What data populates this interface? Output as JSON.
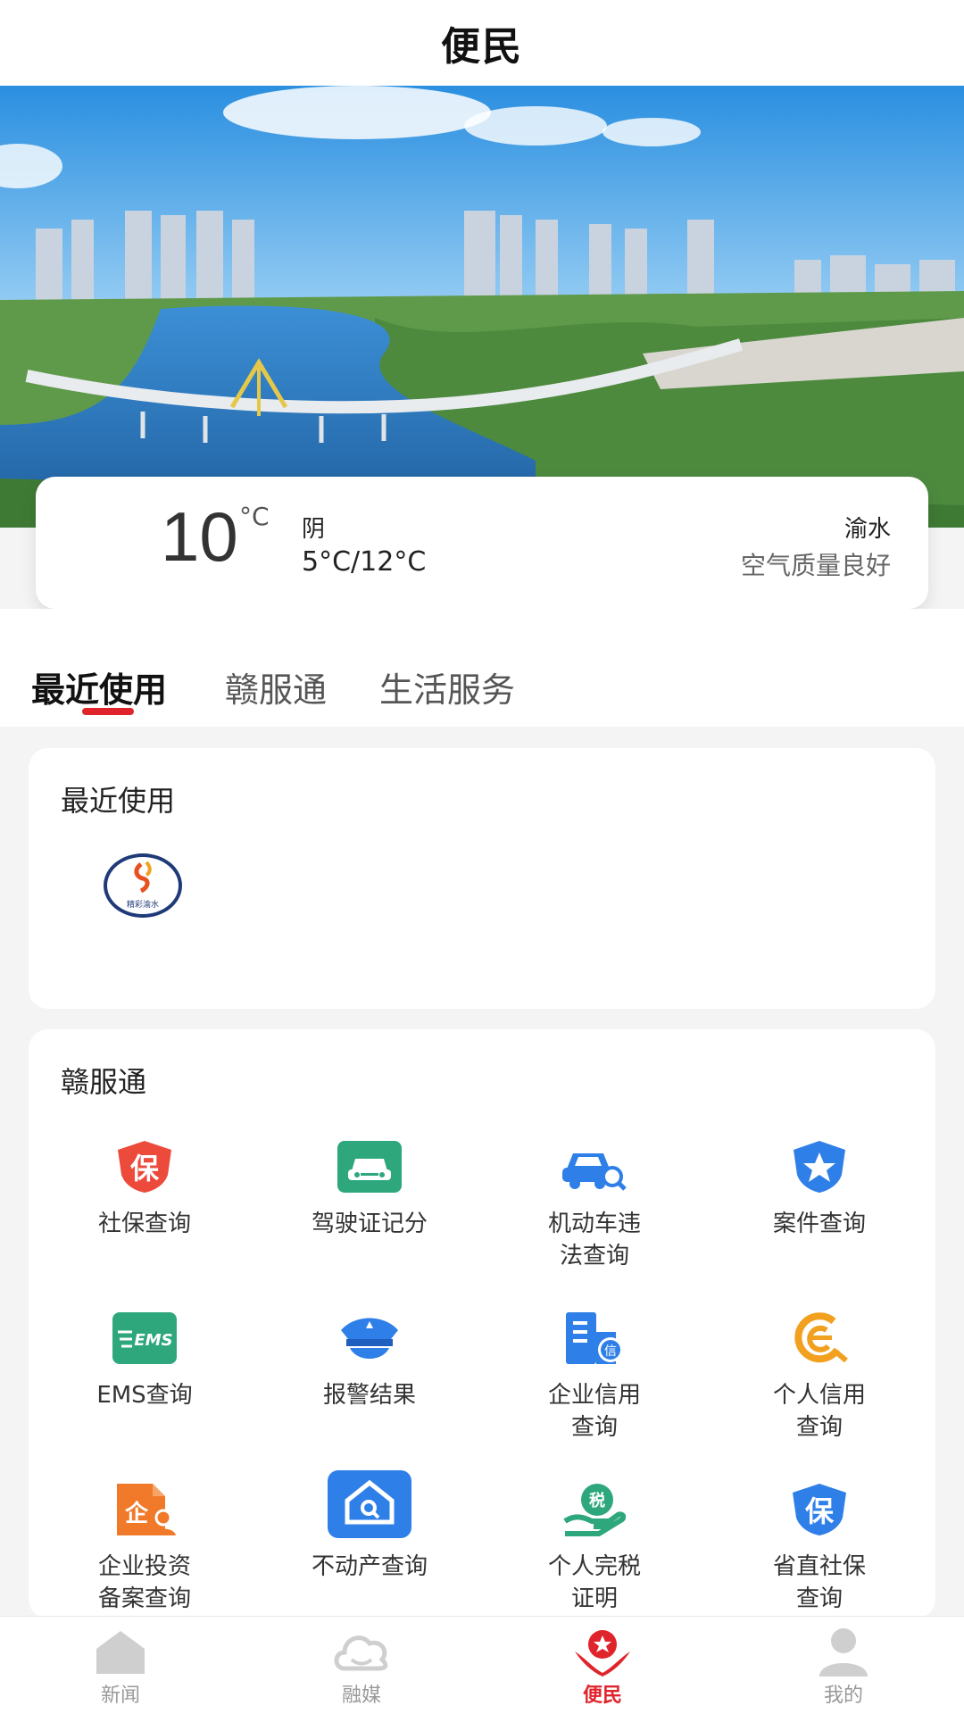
{
  "header": {
    "title": "便民"
  },
  "weather": {
    "temperature": "10",
    "unit": "°C",
    "condition": "阴",
    "range": "5°C/12°C",
    "location": "渝水",
    "air_quality": "空气质量良好"
  },
  "tabs": [
    {
      "label": "最近使用",
      "active": true
    },
    {
      "label": "赣服通",
      "active": false
    },
    {
      "label": "生活服务",
      "active": false
    }
  ],
  "recent": {
    "title": "最近使用",
    "apps": [
      {
        "icon": "xinyu-logo-icon",
        "logo_text": "精彩渝水"
      }
    ]
  },
  "ganfutong": {
    "title": "赣服通",
    "items": [
      {
        "label": "社保查询",
        "icon": "social-security-icon"
      },
      {
        "label": "驾驶证记分",
        "icon": "car-icon"
      },
      {
        "label": "机动车违法查询",
        "icon": "car-search-icon"
      },
      {
        "label": "案件查询",
        "icon": "star-badge-icon"
      },
      {
        "label": "EMS查询",
        "icon": "ems-icon"
      },
      {
        "label": "报警结果",
        "icon": "police-cap-icon"
      },
      {
        "label": "企业信用查询",
        "icon": "enterprise-credit-icon"
      },
      {
        "label": "个人信用查询",
        "icon": "personal-credit-icon"
      },
      {
        "label": "企业投资备案查询",
        "icon": "enterprise-invest-icon"
      },
      {
        "label": "不动产查询",
        "icon": "house-search-icon"
      },
      {
        "label": "个人完税证明",
        "icon": "tax-icon"
      },
      {
        "label": "省直社保查询",
        "icon": "provincial-insurance-icon"
      }
    ]
  },
  "icon_text": {
    "bao": "保",
    "ems": "EMS",
    "xin": "信",
    "qi": "企",
    "shui": "税"
  },
  "bottom_nav": [
    {
      "label": "新闻",
      "icon": "news-icon",
      "active": false
    },
    {
      "label": "融媒",
      "icon": "media-icon",
      "active": false
    },
    {
      "label": "便民",
      "icon": "service-icon",
      "active": true
    },
    {
      "label": "我的",
      "icon": "user-icon",
      "active": false
    }
  ],
  "colors": {
    "accent": "#e0242b",
    "blue": "#2f7fe8",
    "green": "#2ea77d",
    "orange": "#f07a2a"
  }
}
